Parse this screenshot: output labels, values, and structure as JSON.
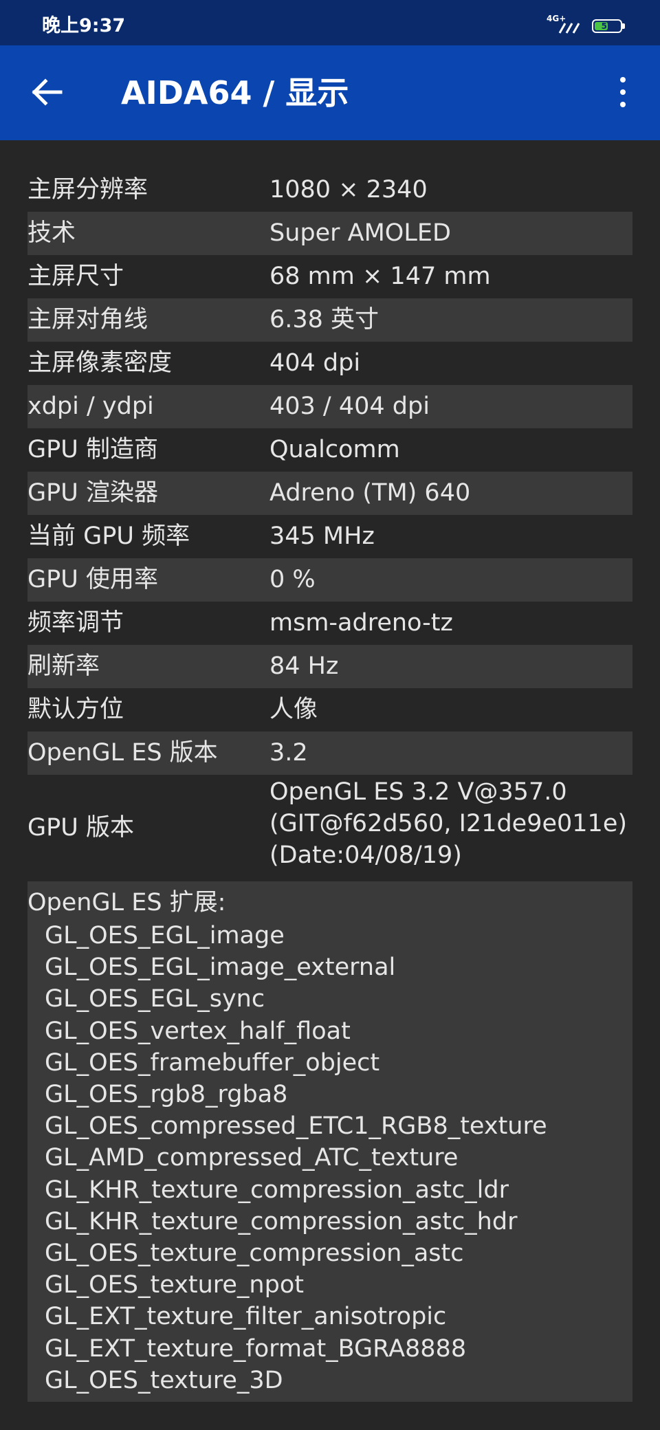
{
  "status_bar": {
    "time": "晚上9:37",
    "network": "4G+",
    "battery_level": "52",
    "battery_fraction": 0.52,
    "battery_color": "#4cc443"
  },
  "app_bar": {
    "title": "AIDA64  /  显示",
    "back_icon": "arrow-left-icon",
    "menu_icon": "more-vertical-icon",
    "color": "#0b46b0"
  },
  "rows": [
    {
      "label": "主屏分辨率",
      "value": "1080 × 2340"
    },
    {
      "label": "技术",
      "value": "Super AMOLED"
    },
    {
      "label": "主屏尺寸",
      "value": "68 mm × 147 mm"
    },
    {
      "label": "主屏对角线",
      "value": "6.38 英寸"
    },
    {
      "label": "主屏像素密度",
      "value": "404 dpi"
    },
    {
      "label": "xdpi / ydpi",
      "value": "403 / 404 dpi"
    },
    {
      "label": "GPU 制造商",
      "value": "Qualcomm"
    },
    {
      "label": "GPU 渲染器",
      "value": "Adreno (TM) 640"
    },
    {
      "label": "当前 GPU 频率",
      "value": "345 MHz"
    },
    {
      "label": "GPU 使用率",
      "value": "0 %"
    },
    {
      "label": "频率调节",
      "value": "msm-adreno-tz"
    },
    {
      "label": "刷新率",
      "value": "84 Hz"
    },
    {
      "label": "默认方位",
      "value": "人像"
    },
    {
      "label": "OpenGL ES 版本",
      "value": "3.2"
    }
  ],
  "gpu_version": {
    "label": "GPU 版本",
    "lines": [
      "OpenGL ES 3.2 V@357.0",
      "(GIT@f62d560, I21de9e011e)",
      "(Date:04/08/19)"
    ]
  },
  "extensions": {
    "title": "OpenGL ES 扩展:",
    "items": [
      "GL_OES_EGL_image",
      "GL_OES_EGL_image_external",
      "GL_OES_EGL_sync",
      "GL_OES_vertex_half_float",
      "GL_OES_framebuffer_object",
      "GL_OES_rgb8_rgba8",
      "GL_OES_compressed_ETC1_RGB8_texture",
      "GL_AMD_compressed_ATC_texture",
      "GL_KHR_texture_compression_astc_ldr",
      "GL_KHR_texture_compression_astc_hdr",
      "GL_OES_texture_compression_astc",
      "GL_OES_texture_npot",
      "GL_EXT_texture_filter_anisotropic",
      "GL_EXT_texture_format_BGRA8888",
      "GL_OES_texture_3D"
    ]
  }
}
